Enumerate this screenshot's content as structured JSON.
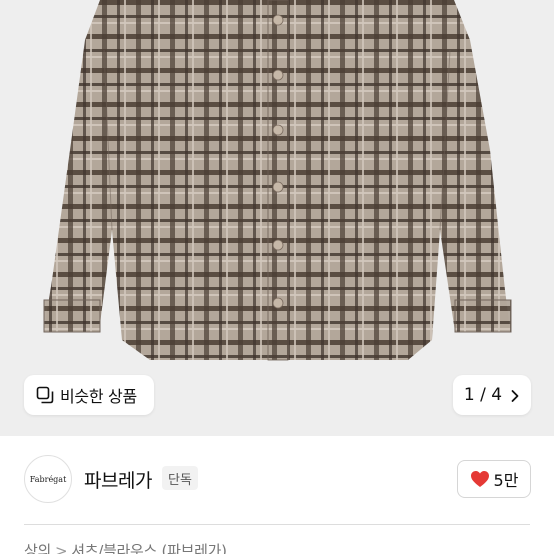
{
  "product_image": {
    "alt_icon": "plaid-shirt-image",
    "colors": {
      "base": "#b0a497",
      "dark": "#3f342c",
      "light": "#d2c8bd",
      "bg": "#eeeeee"
    }
  },
  "similar_button": {
    "icon": "similar-items-icon",
    "label": "비슷한 상품"
  },
  "pager": {
    "label": "1 / 4",
    "icon": "chevron-right-icon"
  },
  "seller": {
    "logo_text": "Fabrégat",
    "name": "파브레가",
    "tag": "단독"
  },
  "like": {
    "icon": "heart-icon",
    "count": "5만",
    "color": "#e53935"
  },
  "breadcrumb": {
    "items": [
      "상의",
      "셔츠/블라우스",
      "(파브레가)"
    ],
    "separator": ">"
  }
}
